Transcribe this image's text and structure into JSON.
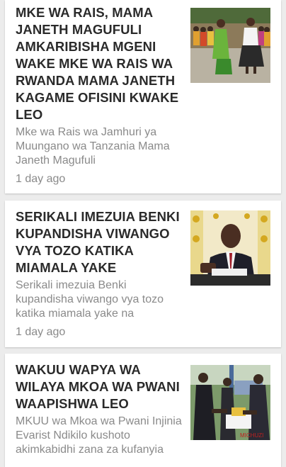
{
  "articles": [
    {
      "title": "MKE WA RAIS, MAMA JANETH MAGUFULI AMKARIBISHA MGENI WAKE MKE WA RAIS WA RWANDA MAMA JANETH KAGAME OFISINI KWAKE LEO",
      "excerpt": "Mke wa Rais wa Jamhuri ya Muungano wa Tanzania Mama Janeth Magufuli",
      "time": "1 day ago",
      "image": "two-women-walking-photo"
    },
    {
      "title": "SERIKALI IMEZUIA BENKI KUPANDISHA VIWANGO VYA TOZO KATIKA MIAMALA YAKE",
      "excerpt": "Serikali imezuia Benki kupandisha viwango vya tozo katika miamala yake na",
      "time": "1 day ago",
      "image": "official-speaking-at-podium-photo"
    },
    {
      "title": "WAKUU WAPYA WA WILAYA MKOA WA PWANI WAAPISHWA LEO",
      "excerpt": "MKUU wa Mkoa wa Pwani Injinia Evarist Ndikilo kushoto akimkabidhi zana za kufanyia",
      "time": "",
      "image": "swearing-in-ceremony-photo"
    }
  ]
}
